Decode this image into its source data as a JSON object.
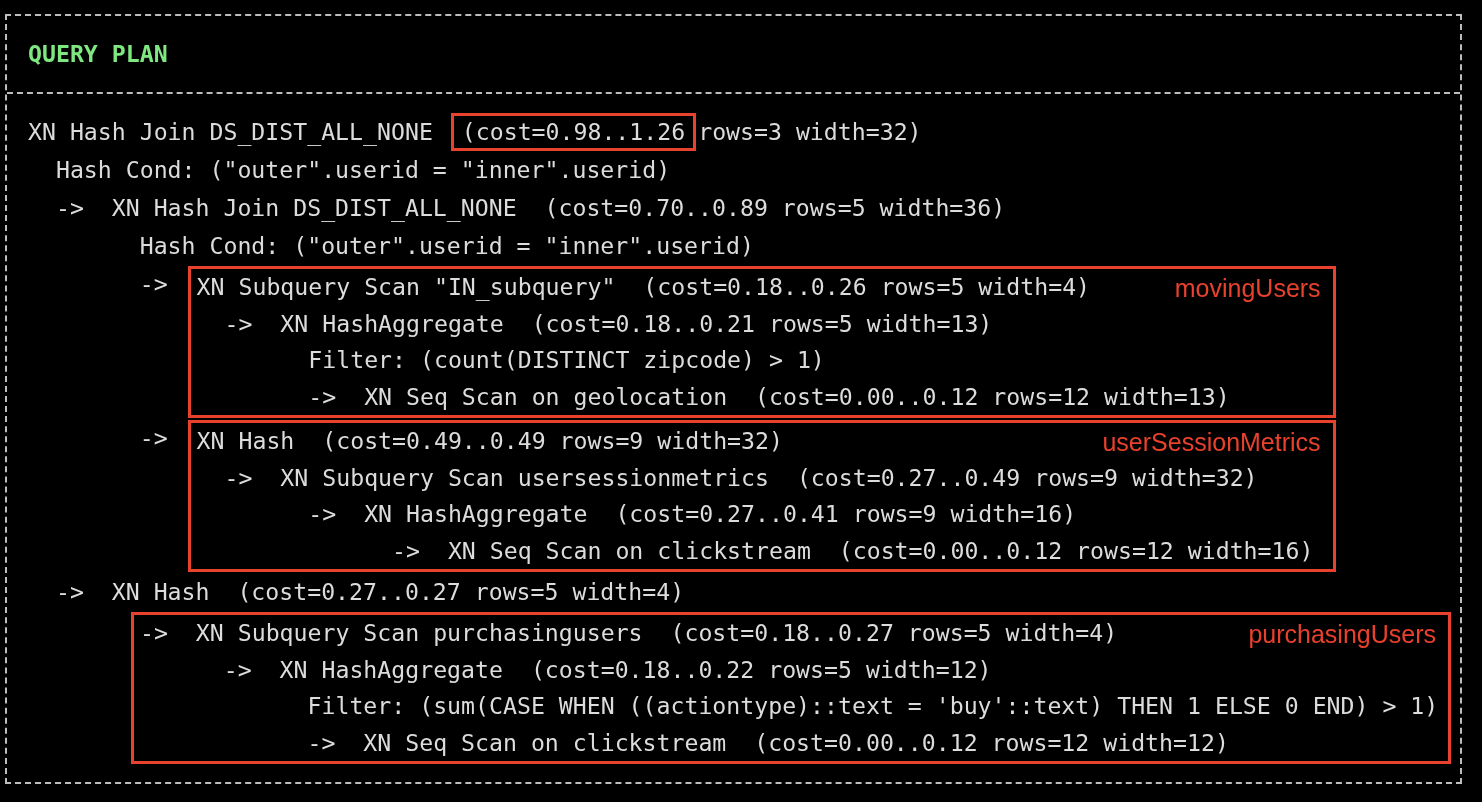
{
  "header": "QUERY PLAN",
  "blocks": [
    {
      "kind": "marked",
      "segments": [
        {
          "text": "XN Hash Join DS_DIST_ALL_NONE ",
          "highlighted": false
        },
        {
          "text": "(cost=0.98..1.26",
          "highlighted": true
        },
        {
          "text": "rows=3 width=32)",
          "highlighted": false
        }
      ]
    },
    {
      "kind": "plain",
      "lines": [
        "  Hash Cond: (\"outer\".userid = \"inner\".userid)",
        "  ->  XN Hash Join DS_DIST_ALL_NONE  (cost=0.70..0.89 rows=5 width=36)",
        "        Hash Cond: (\"outer\".userid = \"inner\".userid)"
      ]
    },
    {
      "kind": "boxed",
      "label": "movingUsers",
      "lead": "        ->",
      "lines": [
        "XN Subquery Scan \"IN_subquery\"  (cost=0.18..0.26 rows=5 width=4)",
        "  ->  XN HashAggregate  (cost=0.18..0.21 rows=5 width=13)",
        "        Filter: (count(DISTINCT zipcode) > 1)",
        "        ->  XN Seq Scan on geolocation  (cost=0.00..0.12 rows=12 width=13)"
      ]
    },
    {
      "kind": "boxed",
      "label": "userSessionMetrics",
      "lead": "        ->",
      "lines": [
        "XN Hash  (cost=0.49..0.49 rows=9 width=32)",
        "  ->  XN Subquery Scan usersessionmetrics  (cost=0.27..0.49 rows=9 width=32)",
        "        ->  XN HashAggregate  (cost=0.27..0.41 rows=9 width=16)",
        "              ->  XN Seq Scan on clickstream  (cost=0.00..0.12 rows=12 width=16)"
      ]
    },
    {
      "kind": "plain",
      "lines": [
        "  ->  XN Hash  (cost=0.27..0.27 rows=5 width=4)"
      ]
    },
    {
      "kind": "boxed",
      "label": "purchasingUsers",
      "lines": [
        "->  XN Subquery Scan purchasingusers  (cost=0.18..0.27 rows=5 width=4)",
        "      ->  XN HashAggregate  (cost=0.18..0.22 rows=5 width=12)",
        "            Filter: (sum(CASE WHEN ((actiontype)::text = 'buy'::text) THEN 1 ELSE 0 END) > 1)",
        "            ->  XN Seq Scan on clickstream  (cost=0.00..0.12 rows=12 width=12)"
      ]
    }
  ]
}
